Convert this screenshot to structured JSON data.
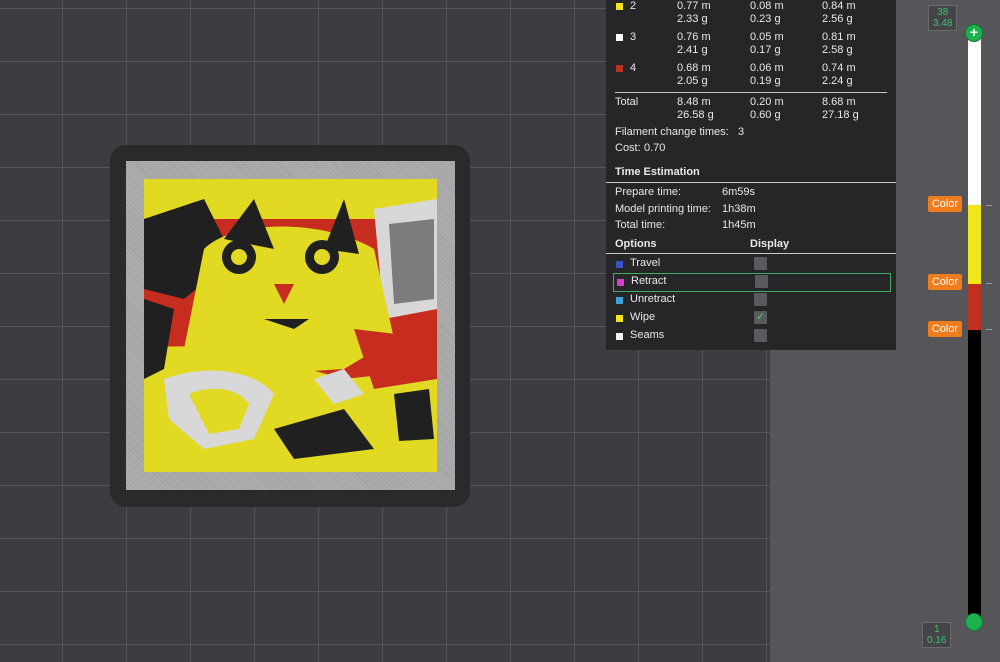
{
  "stats": {
    "filaments": [
      {
        "id": "2",
        "color": "#f1e61c",
        "model": "0.77 m",
        "model_g": "2.33 g",
        "flush": "0.08 m",
        "flush_g": "0.23 g",
        "total": "0.84 m",
        "total_g": "2.56 g"
      },
      {
        "id": "3",
        "color": "#ffffff",
        "model": "0.76 m",
        "model_g": "2.41 g",
        "flush": "0.05 m",
        "flush_g": "0.17 g",
        "total": "0.81 m",
        "total_g": "2.58 g"
      },
      {
        "id": "4",
        "color": "#c0301f",
        "model": "0.68 m",
        "model_g": "2.05 g",
        "flush": "0.06 m",
        "flush_g": "0.19 g",
        "total": "0.74 m",
        "total_g": "2.24 g"
      }
    ],
    "total_label": "Total",
    "total_model": "8.48 m",
    "total_model_g": "26.58 g",
    "total_flush": "0.20 m",
    "total_flush_g": "0.60 g",
    "total_all": "8.68 m",
    "total_all_g": "27.18 g",
    "filament_change_label": "Filament change times:",
    "filament_change_value": "3",
    "cost_label": "Cost:",
    "cost_value": "0.70",
    "time_heading": "Time Estimation",
    "prepare_label": "Prepare time:",
    "prepare_value": "6m59s",
    "model_label": "Model printing time:",
    "model_value": "1h38m",
    "total_time_label": "Total time:",
    "total_time_value": "1h45m",
    "options_heading": "Options",
    "display_heading": "Display",
    "options": [
      {
        "label": "Travel",
        "color": "#3a53c6",
        "checked": ""
      },
      {
        "label": "Retract",
        "color": "#d43fd4",
        "checked": ""
      },
      {
        "label": "Unretract",
        "color": "#3fa1d6",
        "checked": ""
      },
      {
        "label": "Wipe",
        "color": "#f1e61c",
        "checked": "✓"
      },
      {
        "label": "Seams",
        "color": "#f2f2f2",
        "checked": ""
      }
    ]
  },
  "slider": {
    "top_layer": "38",
    "top_height": "3.48",
    "bottom_layer": "1",
    "bottom_height": "0.16",
    "top_handle_icon": "+",
    "color_tag": "Color",
    "segments": [
      {
        "color": "#ffffff"
      },
      {
        "color": "#f1e61c"
      },
      {
        "color": "#c0301f"
      },
      {
        "color": "#000000"
      }
    ]
  }
}
